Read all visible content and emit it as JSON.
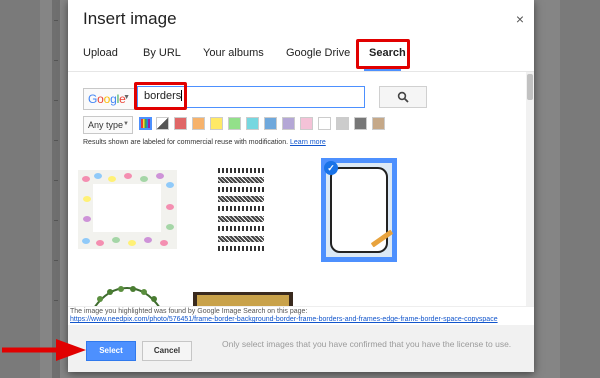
{
  "dialog": {
    "title": "Insert image",
    "close_label": "×"
  },
  "tabs": [
    {
      "label": "Upload",
      "active": false
    },
    {
      "label": "By URL",
      "active": false
    },
    {
      "label": "Your albums",
      "active": false
    },
    {
      "label": "Google Drive",
      "active": false
    },
    {
      "label": "Search",
      "active": true
    }
  ],
  "search": {
    "engine": "Google",
    "query": "borders",
    "button_icon": "search-icon"
  },
  "filters": {
    "type_label": "Any type",
    "colors": [
      "multicolor",
      "black-and-white",
      "#e06666",
      "#f6b26b",
      "#ffe966",
      "#93e08a",
      "#76d7e0",
      "#6fa8dc",
      "#b4a7d6",
      "#f4c2d7",
      "#ffffff",
      "#cccccc",
      "#777777",
      "#c5a888"
    ]
  },
  "notice": {
    "text": "Results shown are labeled for commercial reuse with modification. ",
    "link": "Learn more"
  },
  "results": [
    {
      "name": "floral-frame",
      "selected": false
    },
    {
      "name": "decorative-border-strips",
      "selected": false
    },
    {
      "name": "blue-paper-frame",
      "selected": true
    },
    {
      "name": "vine-frame",
      "selected": false
    },
    {
      "name": "gold-frame",
      "selected": false
    }
  ],
  "attribution": {
    "line1": "The image you highlighted was found by Google Image Search on this page:",
    "url": "https://www.needpix.com/photo/576451/frame-border-background-border-frame-borders-and-frames-edge-frame-border-space-copyspace"
  },
  "footer": {
    "select_label": "Select",
    "cancel_label": "Cancel",
    "license_text": "Only select images that you have confirmed that you have the license to use."
  },
  "colors": {
    "accent": "#4d90fe",
    "highlight_box": "#e10000",
    "arrow": "#e10000"
  }
}
